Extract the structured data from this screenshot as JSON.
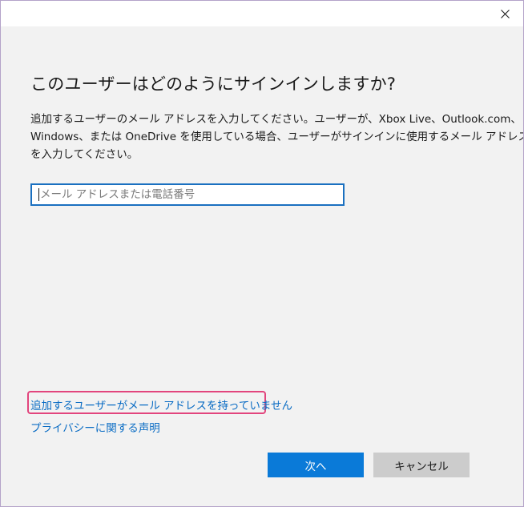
{
  "dialog": {
    "close_icon": "close-icon",
    "heading": "このユーザーはどのようにサインインしますか?",
    "description_lines": [
      "追加するユーザーのメール アドレスを入力してください。ユーザーが、Xbox Live、Outlook.com、",
      "Windows、または OneDrive を使用している場合、ユーザーがサインインに使用するメール アドレス",
      "を入力してください。"
    ],
    "email_input": {
      "value": "",
      "placeholder": "メール アドレスまたは電話番号"
    },
    "no_email_link": "追加するユーザーがメール アドレスを持っていません",
    "privacy_link": "プライバシーに関する声明",
    "next_button": "次へ",
    "cancel_button": "キャンセル"
  },
  "colors": {
    "accent": "#0a7ad8",
    "link": "#0a6cc4",
    "highlight_border": "#e2457d",
    "background": "#f2f2f2"
  }
}
